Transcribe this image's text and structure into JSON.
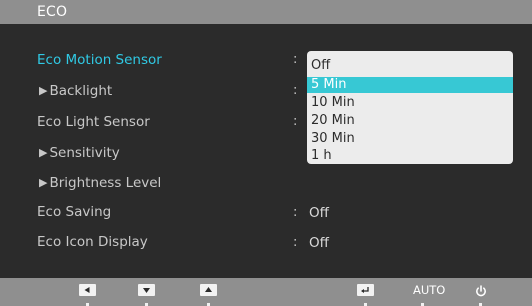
{
  "title": "ECO",
  "menu": {
    "items": [
      {
        "label": "Eco Motion Sensor",
        "colon": ":"
      },
      {
        "label": "Backlight",
        "arrow": "▶",
        "colon": ":"
      },
      {
        "label": "Eco Light Sensor",
        "colon": ":"
      },
      {
        "label": "Sensitivity",
        "arrow": "▶"
      },
      {
        "label": "Brightness Level",
        "arrow": "▶"
      },
      {
        "label": "Eco Saving",
        "colon": ":",
        "value": "Off"
      },
      {
        "label": "Eco Icon Display",
        "colon": ":",
        "value": "Off"
      }
    ]
  },
  "dropdown": {
    "options": [
      "Off",
      "5 Min",
      "10 Min",
      "20 Min",
      "30 Min",
      "1 h"
    ],
    "selected_index": 1
  },
  "bottom": {
    "auto_label": "AUTO",
    "keys": [
      "left-arrow-key-icon",
      "down-arrow-key-icon",
      "up-arrow-key-icon",
      "enter-key-icon",
      "power-icon"
    ]
  },
  "colors": {
    "selected_text": "#30c9e4",
    "dropdown_highlight": "#37c8d4",
    "bar_gray": "#8f8f8f",
    "background": "#2b2b2b"
  }
}
